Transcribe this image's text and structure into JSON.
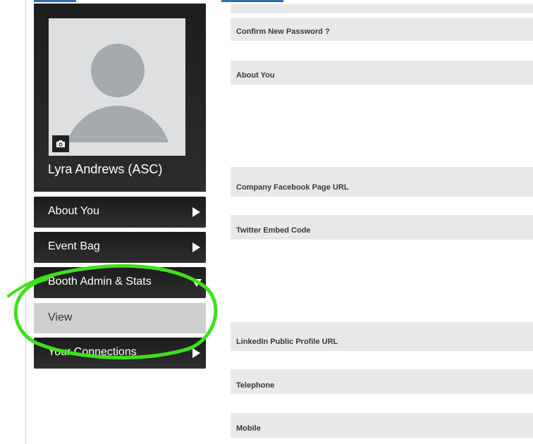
{
  "profile": {
    "name": "Lyra Andrews (ASC)",
    "camera_icon": "camera-icon"
  },
  "menu": {
    "items": [
      {
        "label": "About You",
        "state": "collapsed"
      },
      {
        "label": "Event Bag",
        "state": "collapsed"
      },
      {
        "label": "Booth Admin & Stats",
        "state": "expanded",
        "subitems": [
          {
            "label": "View"
          }
        ]
      },
      {
        "label": "Your Connections",
        "state": "collapsed"
      }
    ]
  },
  "form": {
    "fields": [
      {
        "label": "Confirm New Password ?",
        "value": ""
      },
      {
        "label": "About You",
        "value": ""
      },
      {
        "label": "Company Facebook Page URL",
        "value": ""
      },
      {
        "label": "Twitter Embed Code",
        "value": ""
      },
      {
        "label": "LinkedIn Public Profile URL",
        "value": ""
      },
      {
        "label": "Telephone",
        "value": ""
      },
      {
        "label": "Mobile",
        "value": ""
      }
    ]
  },
  "colors": {
    "menu_bg": "#222222",
    "submenu_bg": "#cfcfcf",
    "form_bg": "#e8e8e8",
    "accent": "#2f6fad",
    "annotation": "#3ee11b"
  }
}
